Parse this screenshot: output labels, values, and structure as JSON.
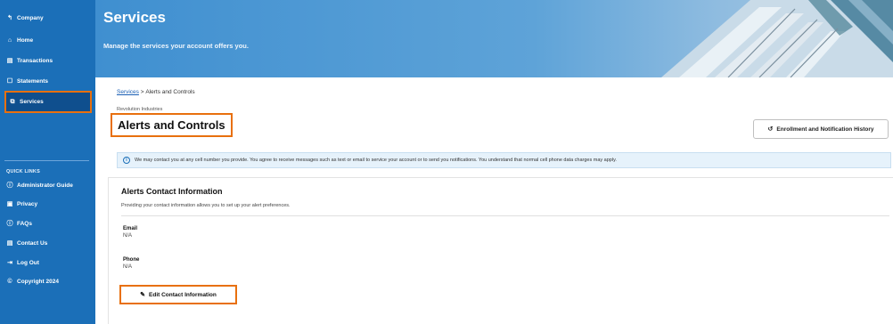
{
  "sidebar": {
    "items": [
      {
        "label": "Company",
        "icon": "back-arrow-icon"
      },
      {
        "label": "Home",
        "icon": "home-icon"
      },
      {
        "label": "Transactions",
        "icon": "transactions-icon"
      },
      {
        "label": "Statements",
        "icon": "statements-icon"
      },
      {
        "label": "Services",
        "icon": "services-icon",
        "active": true
      }
    ],
    "quick_links_heading": "QUICK LINKS",
    "quick_links": [
      {
        "label": "Administrator Guide",
        "icon": "help-circle-icon"
      },
      {
        "label": "Privacy",
        "icon": "privacy-icon"
      },
      {
        "label": "FAQs",
        "icon": "help-circle-icon"
      },
      {
        "label": "Contact Us",
        "icon": "contact-icon"
      },
      {
        "label": "Log Out",
        "icon": "logout-icon"
      },
      {
        "label": "Copyright 2024",
        "icon": "copyright-icon"
      }
    ],
    "accent_color": "#1b6fb8",
    "highlight_color": "#e8700e"
  },
  "banner": {
    "title": "Services",
    "subtitle": "Manage the services your account offers you."
  },
  "breadcrumb": {
    "link": "Services",
    "separator": " > ",
    "current": "Alerts and Controls"
  },
  "page": {
    "company": "Revolution Industries",
    "title": "Alerts and Controls",
    "history_button": "Enrollment and Notification History"
  },
  "notice": "We may contact you at any cell number you provide. You agree to receive messages such as text or email to service your account or to send you notifications. You understand that normal cell phone data charges may apply.",
  "contact": {
    "title": "Alerts Contact Information",
    "description": "Providing your contact information allows you to set up your alert preferences.",
    "email_label": "Email",
    "email_value": "N/A",
    "phone_label": "Phone",
    "phone_value": "N/A",
    "edit_button": "Edit Contact Information"
  }
}
